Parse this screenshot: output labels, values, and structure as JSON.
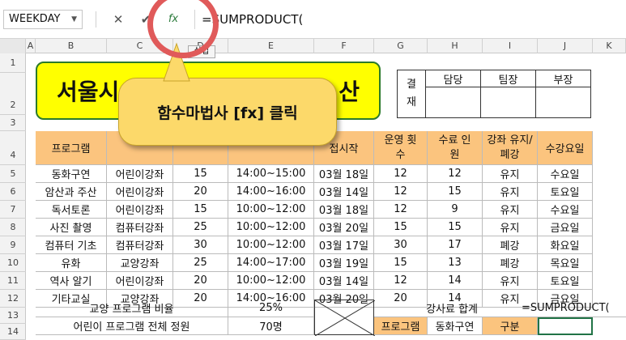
{
  "formula_bar": {
    "name_box": "WEEKDAY",
    "cancel_glyph": "✕",
    "enter_glyph": "✔",
    "fx_glyph": "fx",
    "formula": "=SUMPRODUCT("
  },
  "columns": [
    "A",
    "B",
    "C",
    "D",
    "E",
    "F",
    "G",
    "H",
    "I",
    "J",
    "K"
  ],
  "rows": [
    "1",
    "2",
    "3",
    "4",
    "5",
    "6",
    "7",
    "8",
    "9",
    "10",
    "11",
    "12",
    "13",
    "14"
  ],
  "tooltip_insert": "삽입",
  "title": {
    "left": "서울시",
    "right": "산"
  },
  "approval": {
    "label": "결재",
    "headers": [
      "담당",
      "팀장",
      "부장"
    ]
  },
  "callout": "함수마법사 [fx] 클릭",
  "table_headers": [
    "프로그램",
    "",
    "",
    "",
    "접시작",
    "운영 횟수",
    "수료 인원",
    "강좌 유지/폐강",
    "수강요일"
  ],
  "table_rows": [
    [
      "동화구연",
      "어린이강좌",
      "15",
      "14:00~15:00",
      "03월 18일",
      "12",
      "12",
      "유지",
      "수요일"
    ],
    [
      "암산과 주산",
      "어린이강좌",
      "20",
      "14:00~16:00",
      "03월 14일",
      "12",
      "15",
      "유지",
      "토요일"
    ],
    [
      "독서토론",
      "어린이강좌",
      "15",
      "10:00~12:00",
      "03월 18일",
      "12",
      "9",
      "유지",
      "수요일"
    ],
    [
      "사진 촬영",
      "컴퓨터강좌",
      "25",
      "10:00~12:00",
      "03월 20일",
      "15",
      "15",
      "유지",
      "금요일"
    ],
    [
      "컴퓨터 기초",
      "컴퓨터강좌",
      "30",
      "10:00~12:00",
      "03월 17일",
      "30",
      "17",
      "폐강",
      "화요일"
    ],
    [
      "유화",
      "교양강좌",
      "25",
      "14:00~17:00",
      "03월 19일",
      "15",
      "13",
      "폐강",
      "목요일"
    ],
    [
      "역사 알기",
      "어린이강좌",
      "20",
      "10:00~12:00",
      "03월 14일",
      "12",
      "14",
      "유지",
      "토요일"
    ],
    [
      "기타교실",
      "교양강좌",
      "20",
      "14:00~16:00",
      "03월 20일",
      "20",
      "14",
      "유지",
      "금요일"
    ]
  ],
  "summary": {
    "row13_label": "교양 프로그램 비율",
    "row13_value": "25%",
    "row14_label": "어린이 프로그램 전체 정원",
    "row14_value": "70명",
    "fee_label": "강사료 합계",
    "fee_formula": "=SUMPRODUCT(",
    "program_label": "프로그램",
    "program_value": "동화구연",
    "category_label": "구분"
  }
}
